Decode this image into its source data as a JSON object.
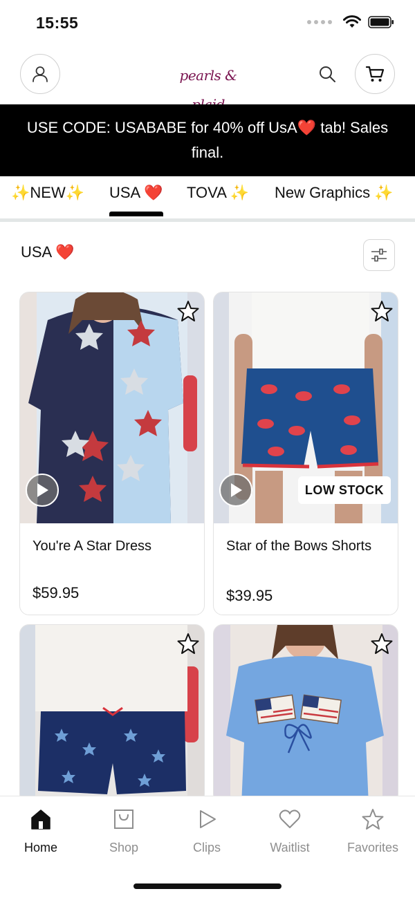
{
  "status_bar": {
    "time": "15:55"
  },
  "header": {
    "logo_text": "pearls & plaid",
    "icons": [
      "account-icon",
      "search-icon",
      "cart-icon"
    ]
  },
  "promo": {
    "text": "USE CODE: USABABE for 40% off UsA❤️ tab! Sales final."
  },
  "tabs": [
    {
      "label": "✨NEW✨",
      "active": false
    },
    {
      "label": "USA ❤️",
      "active": true
    },
    {
      "label": "TOVA ✨",
      "active": false
    },
    {
      "label": "New Graphics ✨",
      "active": false
    }
  ],
  "section": {
    "title": "USA ❤️",
    "filter_icon": "sliders-icon"
  },
  "products": [
    {
      "name": "You're A Star Dress",
      "price": "$59.95",
      "has_video": true,
      "badge": ""
    },
    {
      "name": "Star of the Bows Shorts",
      "price": "$39.95",
      "has_video": true,
      "badge": "LOW STOCK"
    },
    {
      "name": "",
      "price": "",
      "has_video": false,
      "badge": ""
    },
    {
      "name": "",
      "price": "",
      "has_video": false,
      "badge": ""
    }
  ],
  "bottom_nav": [
    {
      "label": "Home",
      "icon": "home-icon",
      "active": true
    },
    {
      "label": "Shop",
      "icon": "shopping-bag-icon",
      "active": false
    },
    {
      "label": "Clips",
      "icon": "play-icon",
      "active": false
    },
    {
      "label": "Waitlist",
      "icon": "heart-icon",
      "active": false
    },
    {
      "label": "Favorites",
      "icon": "star-icon",
      "active": false
    }
  ],
  "colors": {
    "brand": "#7a1450",
    "banner_bg": "#000000",
    "tab_divider": "#e2e6e6",
    "inactive_nav": "#8e8e8e"
  }
}
